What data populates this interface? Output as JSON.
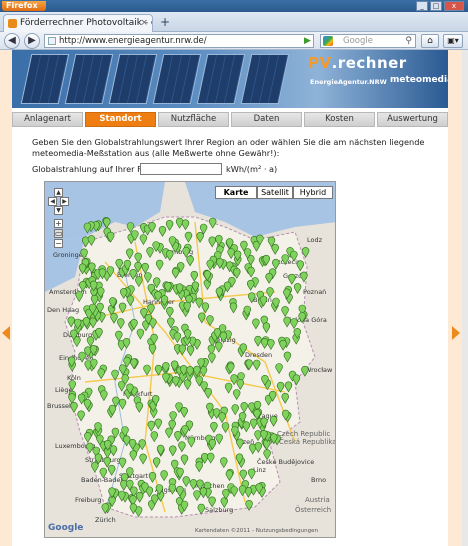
{
  "browser": {
    "app_button": "Firefox",
    "tab_title": "Förderrechner Photovoltaik - ein Service der ...",
    "url": "http://www.energieagentur.nrw.de/",
    "search_placeholder": "Google"
  },
  "banner": {
    "title_prefix": "PV",
    "title_suffix": ".rechner",
    "brand_left": "EnergieAgentur.NRW",
    "brand_right": "meteomedia"
  },
  "steps": [
    {
      "label": "Anlagenart",
      "active": false
    },
    {
      "label": "Standort",
      "active": true
    },
    {
      "label": "Nutzfläche",
      "active": false
    },
    {
      "label": "Daten",
      "active": false
    },
    {
      "label": "Kosten",
      "active": false
    },
    {
      "label": "Auswertung",
      "active": false
    }
  ],
  "instructions": "Geben Sie den Globalstrahlungswert Ihrer Region an oder wählen Sie die am nächsten liegende meteomedia-Meßstation aus (alle Meßwerte ohne Gewähr!):",
  "form": {
    "label": "Globalstrahlung auf Ihrer Fläche:",
    "value": "",
    "unit": "kWh/(m² · a)"
  },
  "map": {
    "types": [
      "Karte",
      "Satellit",
      "Hybrid"
    ],
    "active_type": "Karte",
    "logo": "Google",
    "copyright": "Kartendaten ©2011 - Nutzungsbedingungen",
    "cities": [
      "Groningen",
      "Hamburg",
      "Szczecin",
      "Bremen",
      "Berlin",
      "Hannover",
      "Poznań",
      "Amsterdam",
      "Den Haag",
      "Duisburg",
      "Leipzig",
      "Dresden",
      "Eindhoven",
      "Köln",
      "Wrocław",
      "Brussels",
      "Frankfurt",
      "Prague",
      "Luxembourg",
      "Nürnberg",
      "Plzeň",
      "Czech Republic",
      "Česká Republika",
      "Stuttgart",
      "München",
      "Freiburg",
      "Zürich",
      "Salzburg",
      "Linz",
      "České Budějovice",
      "Austria",
      "Österreich",
      "Brno",
      "Lodz",
      "Gorzów",
      "Zielona Góra",
      "Liège",
      "Strasbourg",
      "Baden-Baden",
      "Augsburg"
    ],
    "marker_color": "#7fd35c"
  }
}
